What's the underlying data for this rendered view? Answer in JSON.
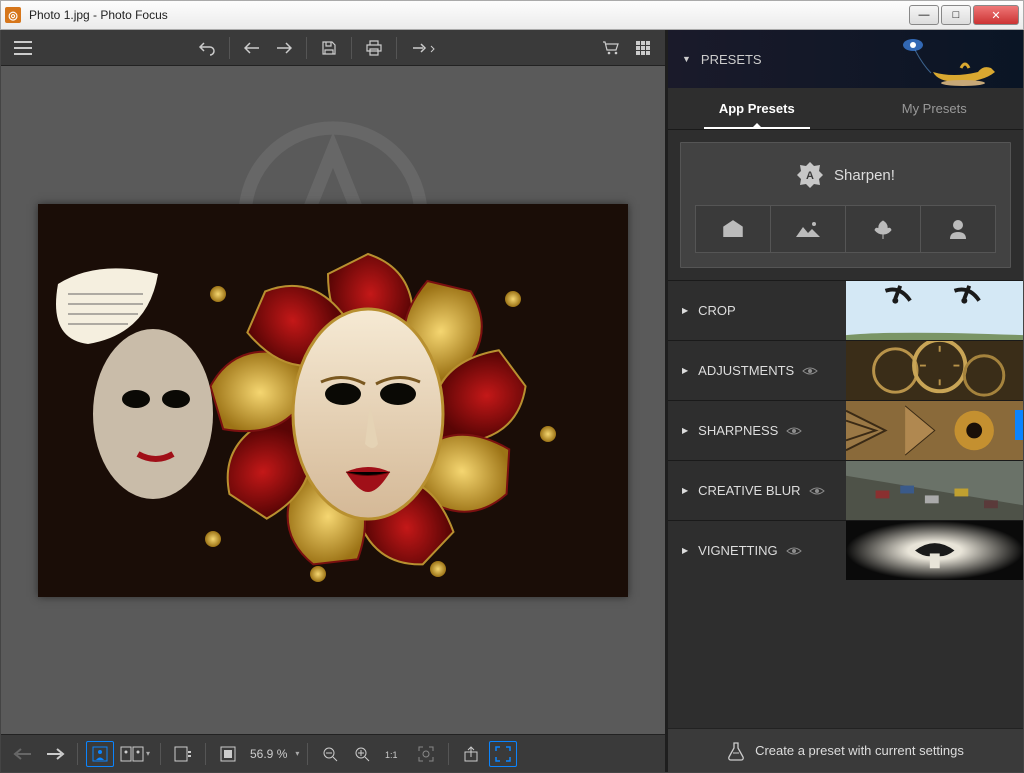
{
  "window": {
    "title": "Photo 1.jpg - Photo Focus"
  },
  "toolbar": {
    "menu": "menu",
    "undo": "undo",
    "back": "back",
    "forward": "forward",
    "save": "save",
    "print": "print",
    "share": "share",
    "cart": "cart",
    "grid": "grid"
  },
  "bottombar": {
    "zoom": "56.9 %"
  },
  "presets": {
    "header": "PRESETS",
    "tabs": {
      "app": "App Presets",
      "my": "My Presets"
    },
    "sharpen": "Sharpen!",
    "sharpen_badge": "A",
    "sections": {
      "crop": "CROP",
      "adjustments": "ADJUSTMENTS",
      "sharpness": "SHARPNESS",
      "creative_blur": "CREATIVE BLUR",
      "vignetting": "VIGNETTING"
    },
    "create": "Create a preset with current settings"
  }
}
